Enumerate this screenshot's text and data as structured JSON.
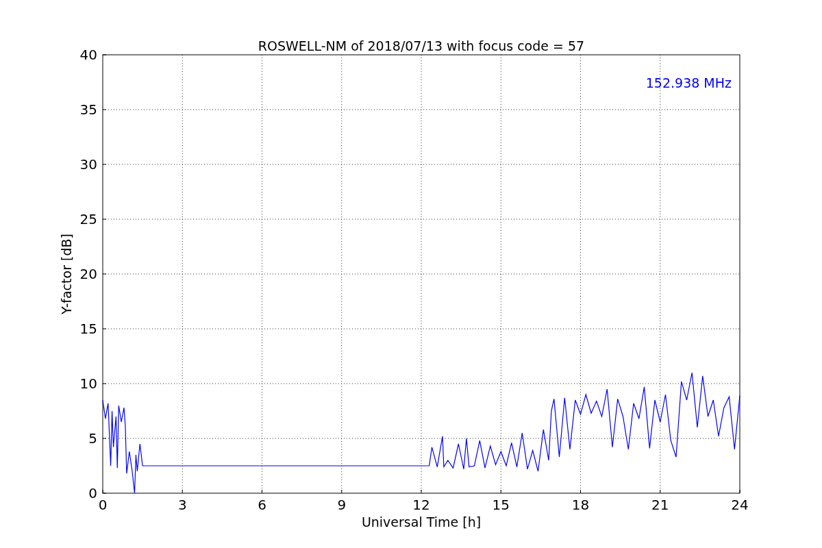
{
  "chart_data": {
    "type": "line",
    "title": "ROSWELL-NM of 2018/07/13 with focus code = 57",
    "xlabel": "Universal Time [h]",
    "ylabel": "Y-factor [dB]",
    "x": [
      0,
      0.1,
      0.2,
      0.3,
      0.35,
      0.4,
      0.5,
      0.55,
      0.6,
      0.7,
      0.8,
      0.85,
      0.9,
      1.0,
      1.1,
      1.2,
      1.25,
      1.3,
      1.4,
      1.5,
      12.3,
      12.4,
      12.6,
      12.8,
      12.85,
      13.0,
      13.2,
      13.4,
      13.6,
      13.7,
      13.8,
      14.0,
      14.2,
      14.4,
      14.6,
      14.8,
      15.0,
      15.2,
      15.4,
      15.6,
      15.8,
      16.0,
      16.2,
      16.4,
      16.6,
      16.8,
      16.9,
      17.0,
      17.2,
      17.4,
      17.6,
      17.8,
      18.0,
      18.2,
      18.4,
      18.6,
      18.8,
      19.0,
      19.2,
      19.4,
      19.6,
      19.8,
      20.0,
      20.2,
      20.4,
      20.6,
      20.8,
      21.0,
      21.2,
      21.4,
      21.6,
      21.8,
      22.0,
      22.2,
      22.4,
      22.6,
      22.8,
      23.0,
      23.2,
      23.4,
      23.6,
      23.8,
      24.0
    ],
    "series": [
      {
        "name": "152.938 MHz",
        "color": "#0000ff",
        "values": [
          8.5,
          6.8,
          8.2,
          2.5,
          7.5,
          4.2,
          7.0,
          2.3,
          8.0,
          6.5,
          7.8,
          6.2,
          1.8,
          3.8,
          2.2,
          0,
          3.5,
          2.0,
          4.5,
          2.5,
          2.5,
          4.2,
          2.4,
          5.2,
          2.4,
          3.0,
          2.3,
          4.5,
          2.2,
          5.0,
          2.4,
          2.5,
          4.8,
          2.3,
          4.3,
          2.6,
          3.8,
          2.5,
          4.6,
          2.4,
          5.5,
          2.2,
          3.9,
          2.0,
          5.8,
          3.0,
          7.5,
          8.6,
          3.3,
          8.7,
          4.0,
          8.5,
          7.2,
          9.0,
          7.3,
          8.4,
          7.0,
          9.5,
          4.2,
          8.6,
          7.0,
          4.0,
          8.2,
          6.8,
          9.7,
          4.1,
          8.5,
          6.5,
          9.0,
          4.8,
          3.3,
          10.2,
          8.5,
          11.0,
          6.0,
          10.7,
          7.0,
          8.5,
          5.2,
          7.8,
          8.8,
          4.0,
          8.9
        ]
      }
    ],
    "xlim": [
      0,
      24
    ],
    "ylim": [
      0,
      40
    ],
    "xticks": [
      0,
      3,
      6,
      9,
      12,
      15,
      18,
      21,
      24
    ],
    "yticks": [
      0,
      5,
      10,
      15,
      20,
      25,
      30,
      35,
      40
    ],
    "grid": true
  }
}
